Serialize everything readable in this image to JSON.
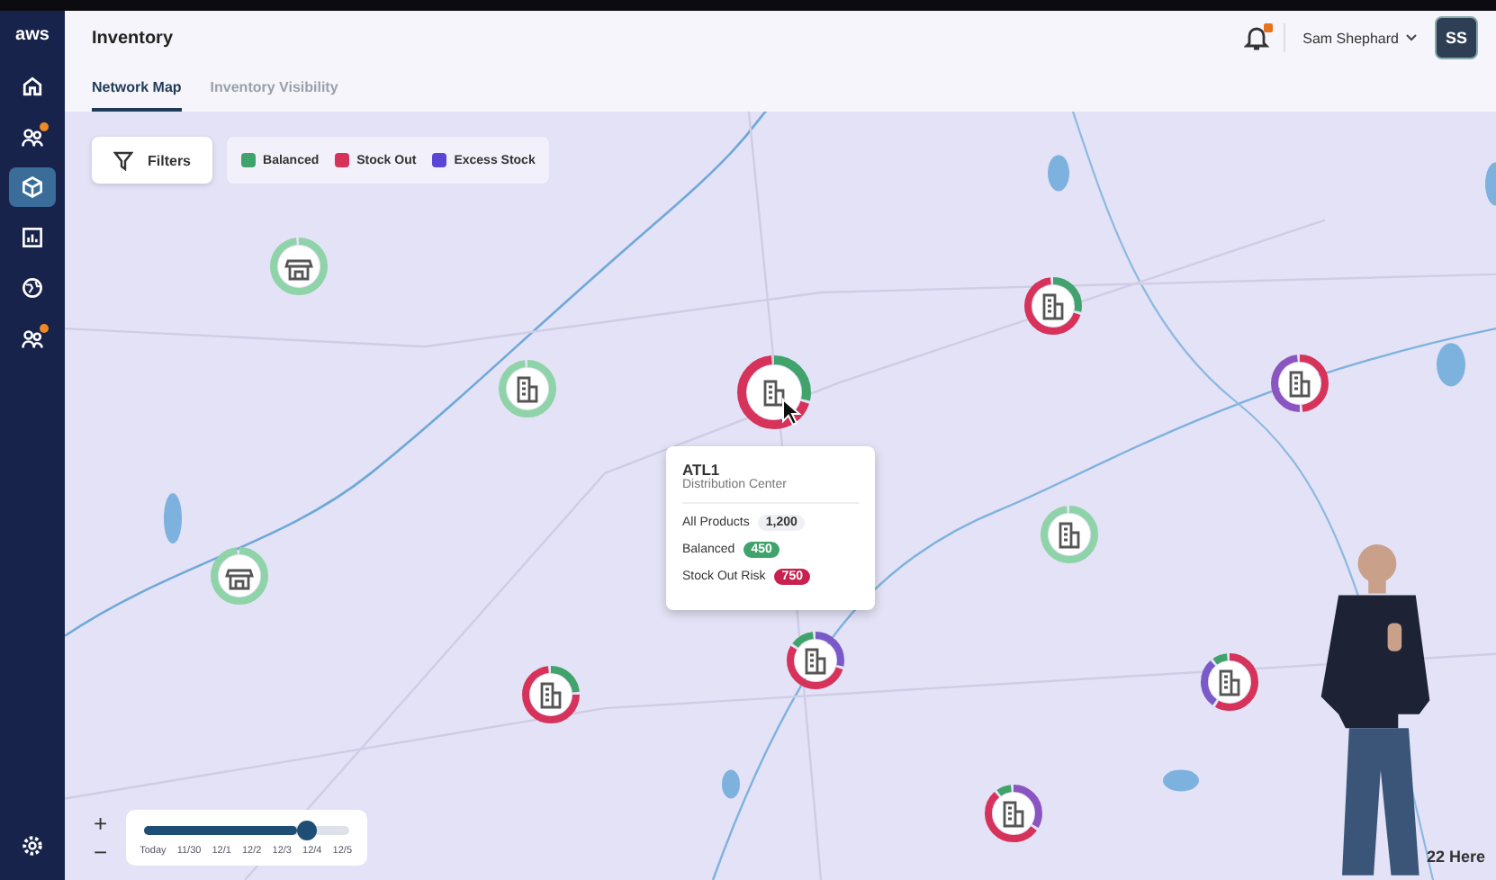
{
  "sidebar": {
    "logo": "aws",
    "items": [
      {
        "selected": false
      },
      {
        "selected": false,
        "badge": true
      },
      {
        "selected": true
      },
      {
        "selected": false
      },
      {
        "selected": false
      },
      {
        "selected": false,
        "badge": true
      }
    ]
  },
  "header": {
    "title": "Inventory",
    "user": "Sam Shephard",
    "avatar": "SS",
    "notification": true
  },
  "tabs": [
    {
      "label": "Network Map",
      "selected": true
    },
    {
      "label": "Inventory Visibility",
      "selected": false
    }
  ],
  "filters": {
    "label": "Filters",
    "legend": [
      {
        "label": "Balanced",
        "color": "#3fa36b"
      },
      {
        "label": "Stock Out",
        "color": "#d6325a"
      },
      {
        "label": "Excess Stock",
        "color": "#5b45d6"
      }
    ]
  },
  "map": {
    "attribution": "22 Here",
    "locations": [
      {
        "kind": "store",
        "balanced": true,
        "selected": false
      },
      {
        "kind": "warehouse",
        "balanced": true,
        "selected": false
      },
      {
        "kind": "store",
        "balanced": true,
        "selected": false
      },
      {
        "kind": "warehouse",
        "balanced": false,
        "selected": true
      },
      {
        "kind": "warehouse",
        "balanced": false,
        "selected": false
      },
      {
        "kind": "warehouse",
        "balanced": false,
        "selected": false
      },
      {
        "kind": "warehouse",
        "balanced": true,
        "selected": false
      },
      {
        "kind": "warehouse",
        "balanced": false,
        "selected": false
      },
      {
        "kind": "warehouse",
        "balanced": false,
        "selected": false
      },
      {
        "kind": "warehouse",
        "balanced": false,
        "selected": false
      },
      {
        "kind": "warehouse",
        "balanced": false,
        "selected": false
      }
    ],
    "popup": {
      "title": "ATL1",
      "subtitle": "Distribution Center",
      "rows": [
        {
          "label": "All Products",
          "value": "1,200",
          "kind": "neutral"
        },
        {
          "label": "Balanced",
          "value": "450",
          "kind": "balanced"
        },
        {
          "label": "Stock Out Risk",
          "value": "750",
          "kind": "stock_out"
        }
      ]
    }
  },
  "timeline": {
    "zoom_in": "+",
    "zoom_out": "−",
    "level": 0.8,
    "dates": [
      "Today",
      "11/30",
      "12/1",
      "12/2",
      "12/3",
      "12/4",
      "12/5"
    ]
  },
  "presenter": {
    "kind": "person"
  }
}
